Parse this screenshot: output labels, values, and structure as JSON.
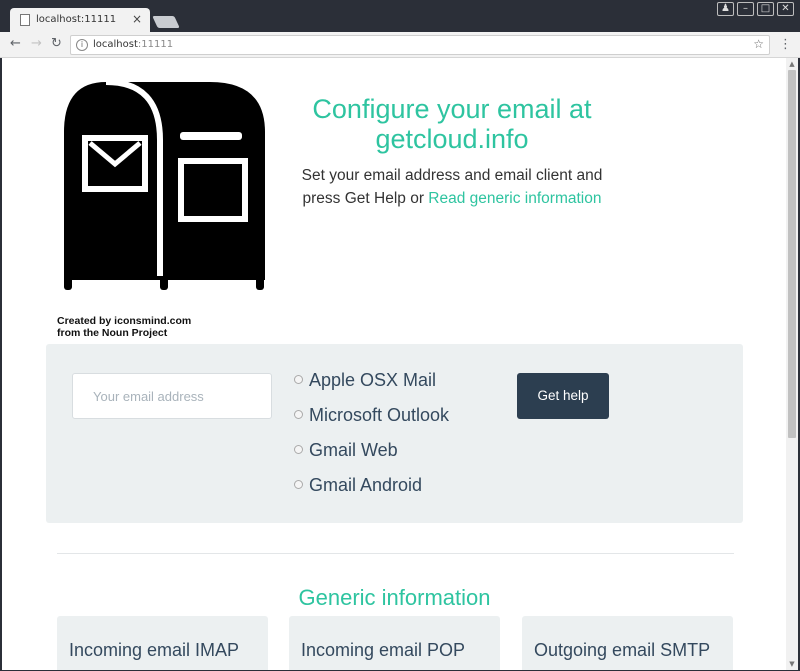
{
  "browser": {
    "tab_title": "localhost:11111",
    "tab_close": "×",
    "url_host": "localhost",
    "url_port": ":11111",
    "window_buttons": [
      "person",
      "minimize",
      "maximize",
      "close"
    ]
  },
  "hero": {
    "title": "Configure your email at getcloud.info",
    "subtitle_text": "Set your email address and email client and press Get Help or",
    "subtitle_link": "Read generic information"
  },
  "credit": {
    "line1": "Created by iconsmind.com",
    "line2": "from the Noun Project"
  },
  "form": {
    "email_placeholder": "Your email address",
    "clients": [
      {
        "label": "Apple OSX Mail"
      },
      {
        "label": "Microsoft Outlook"
      },
      {
        "label": "Gmail Web"
      },
      {
        "label": "Gmail Android"
      }
    ],
    "submit_label": "Get help"
  },
  "generic": {
    "title": "Generic information",
    "cards": [
      {
        "label": "Incoming email IMAP"
      },
      {
        "label": "Incoming email POP"
      },
      {
        "label": "Outgoing email SMTP"
      }
    ]
  },
  "colors": {
    "accent": "#2ec4a0",
    "button": "#2c3e50",
    "panel": "#ecf0f1"
  }
}
